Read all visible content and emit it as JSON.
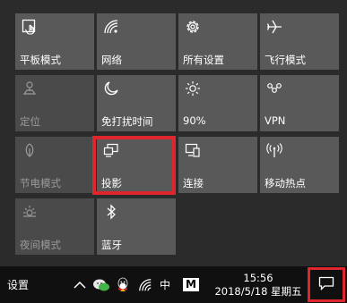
{
  "tiles": [
    {
      "label": "平板模式",
      "icon": "tablet-mode-icon",
      "active": true
    },
    {
      "label": "网络",
      "icon": "network-icon",
      "active": true
    },
    {
      "label": "所有设置",
      "icon": "settings-gear-icon",
      "active": true
    },
    {
      "label": "飞行模式",
      "icon": "airplane-icon",
      "active": true
    },
    {
      "label": "定位",
      "icon": "location-icon",
      "active": false
    },
    {
      "label": "免打扰时间",
      "icon": "moon-icon",
      "active": true
    },
    {
      "label": "90%",
      "icon": "brightness-icon",
      "active": true
    },
    {
      "label": "VPN",
      "icon": "vpn-icon",
      "active": true
    },
    {
      "label": "节电模式",
      "icon": "battery-saver-icon",
      "active": false
    },
    {
      "label": "投影",
      "icon": "project-icon",
      "active": true
    },
    {
      "label": "连接",
      "icon": "connect-icon",
      "active": true
    },
    {
      "label": "移动热点",
      "icon": "hotspot-icon",
      "active": true
    },
    {
      "label": "夜间模式",
      "icon": "night-light-icon",
      "active": false
    },
    {
      "label": "蓝牙",
      "icon": "bluetooth-icon",
      "active": true
    }
  ],
  "taskbar": {
    "settings_label": "设置",
    "ime_label": "中",
    "ime_mode": "M",
    "time": "15:56",
    "date": "2018/5/18 星期五"
  },
  "colors": {
    "highlight": "#e0262d",
    "tile_on": "#595959",
    "tile_off": "#4a4a4a"
  }
}
